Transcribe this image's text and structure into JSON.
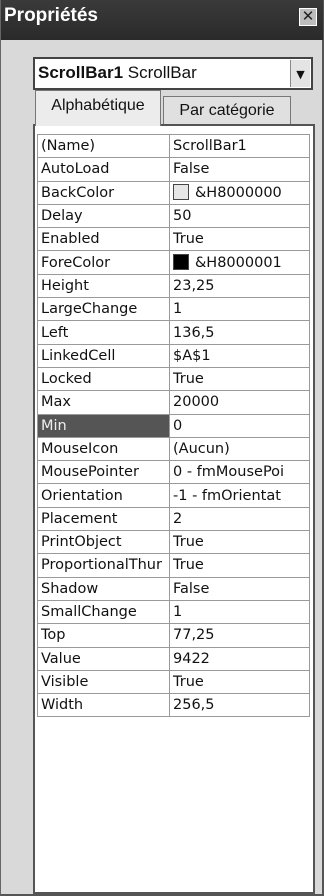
{
  "window": {
    "title": "Propriétés",
    "close_glyph": "✕"
  },
  "object_selector": {
    "name": "ScrollBar1",
    "type": "ScrollBar",
    "arrow_glyph": "▼"
  },
  "tabs": [
    {
      "label": "Alphabétique",
      "active": true
    },
    {
      "label": "Par catégorie",
      "active": false
    }
  ],
  "selected_property": "Min",
  "properties": [
    {
      "name": "(Name)",
      "value": "ScrollBar1"
    },
    {
      "name": "AutoLoad",
      "value": "False"
    },
    {
      "name": "BackColor",
      "value": "&H8000000",
      "swatch": "light"
    },
    {
      "name": "Delay",
      "value": "50"
    },
    {
      "name": "Enabled",
      "value": "True"
    },
    {
      "name": "ForeColor",
      "value": "&H8000001",
      "swatch": "dark"
    },
    {
      "name": "Height",
      "value": "23,25"
    },
    {
      "name": "LargeChange",
      "value": "1"
    },
    {
      "name": "Left",
      "value": "136,5"
    },
    {
      "name": "LinkedCell",
      "value": "$A$1"
    },
    {
      "name": "Locked",
      "value": "True"
    },
    {
      "name": "Max",
      "value": "20000"
    },
    {
      "name": "Min",
      "value": "0"
    },
    {
      "name": "MouseIcon",
      "value": "(Aucun)"
    },
    {
      "name": "MousePointer",
      "value": "0 - fmMousePoi"
    },
    {
      "name": "Orientation",
      "value": "-1 - fmOrientat"
    },
    {
      "name": "Placement",
      "value": "2"
    },
    {
      "name": "PrintObject",
      "value": "True"
    },
    {
      "name": "ProportionalThur",
      "value": "True"
    },
    {
      "name": "Shadow",
      "value": "False"
    },
    {
      "name": "SmallChange",
      "value": "1"
    },
    {
      "name": "Top",
      "value": "77,25"
    },
    {
      "name": "Value",
      "value": "9422"
    },
    {
      "name": "Visible",
      "value": "True"
    },
    {
      "name": "Width",
      "value": "256,5"
    }
  ]
}
